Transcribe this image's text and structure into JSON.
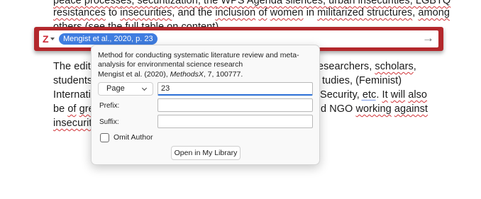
{
  "document": {
    "line_top": [
      "peace processes, securitization, the WPS Agenda silences, urban insecurities, LGBTQ"
    ],
    "line1": [
      "resistances",
      " to ",
      "insecurities",
      ", and the ",
      "inclusion",
      " ",
      "of",
      " ",
      "women",
      " in ",
      "militarized structures",
      ", ",
      "among"
    ],
    "line2": "others (see the full table on content)",
    "line3_left": "The edite",
    "line3_right_parts": [
      "esearchers, ",
      "scholars",
      ","
    ],
    "line4_left": "students",
    "line4_right": "tudies, (Feminist)",
    "line5_left": "Internati",
    "line5_right_parts": [
      "Security, ",
      "etc",
      ". ",
      "It",
      " ",
      "will",
      " ",
      "also"
    ],
    "line6_left_parts": [
      "be ",
      "of",
      " ",
      "gre"
    ],
    "line6_right_parts": [
      "d NGO ",
      "working",
      " ",
      "against"
    ],
    "line7_left": "insecurit"
  },
  "citation_bar": {
    "logo": "Z",
    "bubble": "Mengist et al., 2020, p. 23",
    "accept_icon": "→"
  },
  "popover": {
    "title": "Method for conducting systematic literature review and meta-analysis for environmental science research",
    "meta_prefix": "Mengist et al. (2020), ",
    "meta_journal": "MethodsX",
    "meta_suffix": ", 7, 100777.",
    "locator_type": "Page",
    "locator_value": "23",
    "prefix_label": "Prefix:",
    "prefix_value": "",
    "suffix_label": "Suffix:",
    "suffix_value": "",
    "omit_author_label": "Omit Author",
    "omit_author_checked": false,
    "open_library_label": "Open in My Library"
  },
  "colors": {
    "bar": "#b3282c",
    "bubble": "#3f7de0",
    "focus": "#2b6fd6"
  }
}
